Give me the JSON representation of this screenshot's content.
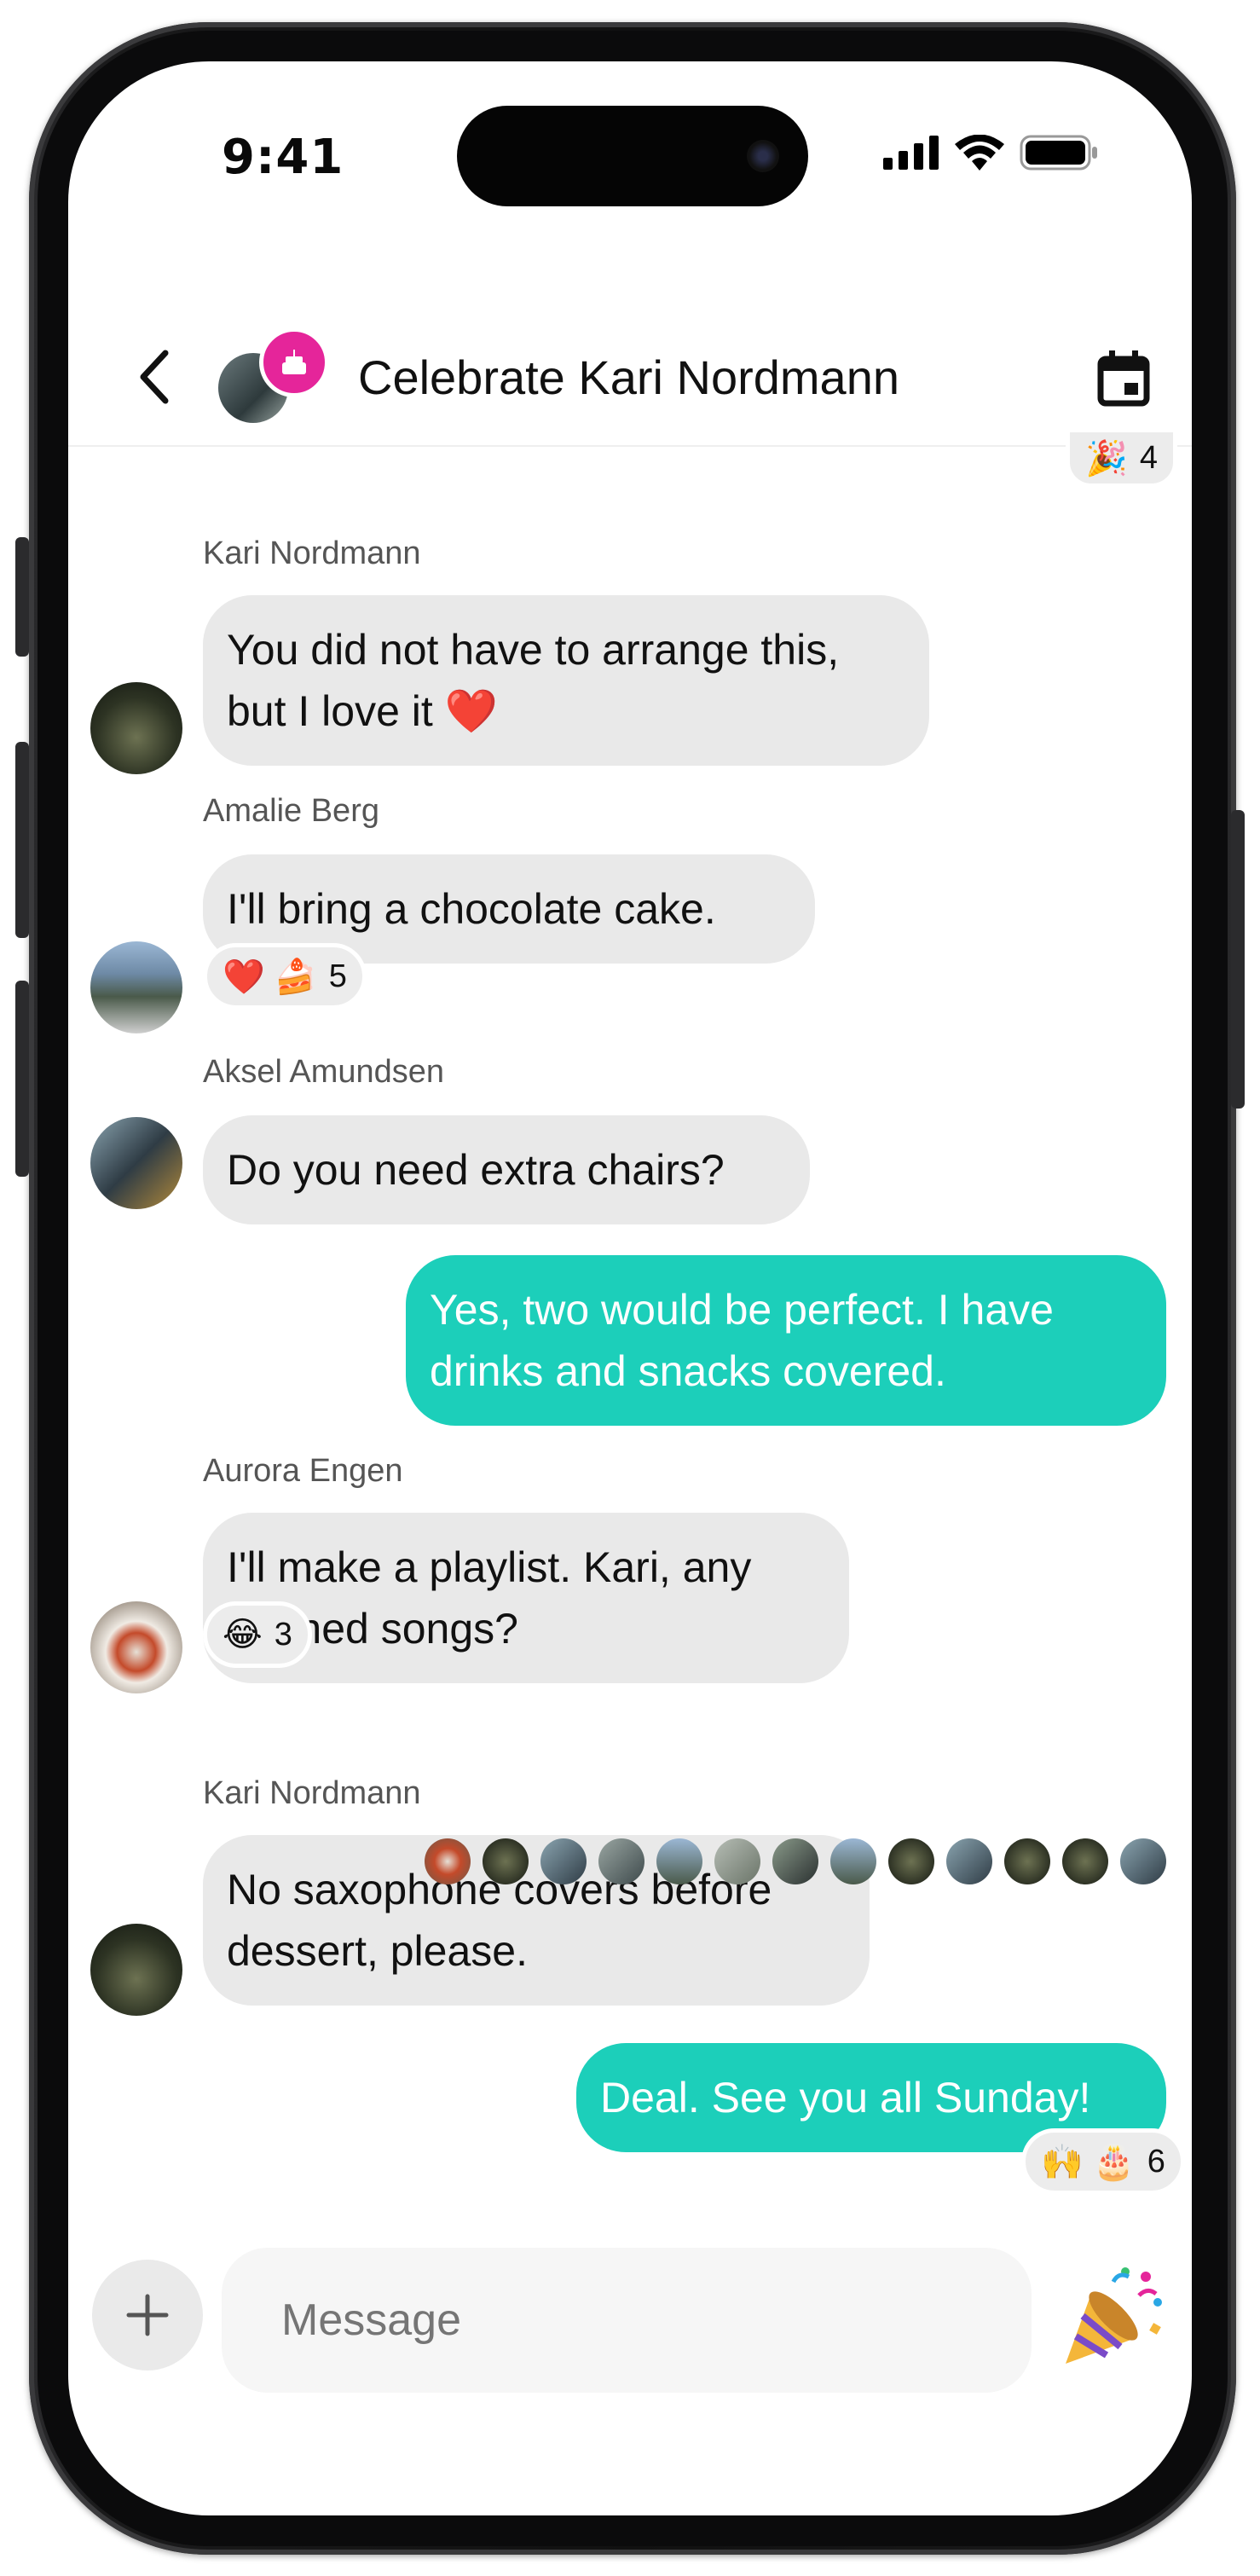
{
  "status": {
    "time": "9:41"
  },
  "header": {
    "title": "Celebrate Kari Nordmann",
    "top_reaction": {
      "emoji": "🎉",
      "count": "4"
    }
  },
  "messages": [
    {
      "sender": "Kari Nordmann",
      "lines": [
        "You did not have to arrange this,",
        "but I love it ❤️"
      ]
    },
    {
      "sender": "Amalie Berg",
      "lines": [
        "I'll bring a chocolate cake."
      ],
      "reactions": {
        "emojis": "❤️ 🍰",
        "count": "5"
      }
    },
    {
      "sender": "Aksel Amundsen",
      "lines": [
        "Do you need extra chairs?"
      ]
    },
    {
      "sender": "me",
      "lines": [
        "Yes, two would be perfect. I have",
        "drinks and snacks covered."
      ]
    },
    {
      "sender": "Aurora Engen",
      "lines": [
        "I'll make a playlist. Kari, any",
        "banned songs?"
      ],
      "reactions": {
        "emojis": "😂",
        "count": "3"
      }
    },
    {
      "sender": "Kari Nordmann",
      "lines": [
        "No saxophone covers before",
        "dessert, please."
      ]
    },
    {
      "sender": "me",
      "lines": [
        "Deal. See you all Sunday!"
      ],
      "reactions": {
        "emojis": "🙌 🎂",
        "count": "6"
      }
    }
  ],
  "composer": {
    "placeholder": "Message",
    "party_emoji": "🎉"
  },
  "colors": {
    "accent": "#1ccfba",
    "badge": "#e5259a",
    "bubble_other": "#e9e9e9"
  }
}
